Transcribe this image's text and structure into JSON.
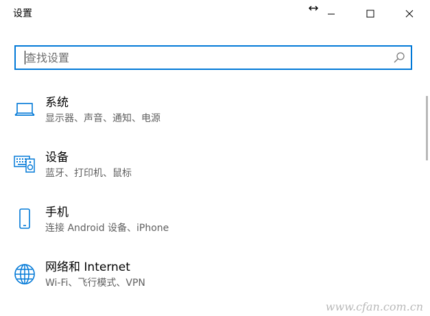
{
  "window": {
    "title": "设置"
  },
  "search": {
    "placeholder": "查找设置",
    "value": ""
  },
  "items": [
    {
      "icon": "laptop-icon",
      "title": "系统",
      "subtitle": "显示器、声音、通知、电源"
    },
    {
      "icon": "keyboard-speaker-icon",
      "title": "设备",
      "subtitle": "蓝牙、打印机、鼠标"
    },
    {
      "icon": "phone-icon",
      "title": "手机",
      "subtitle": "连接 Android 设备、iPhone"
    },
    {
      "icon": "globe-icon",
      "title": "网络和 Internet",
      "subtitle": "Wi-Fi、飞行模式、VPN"
    }
  ],
  "watermark": "www.cfan.com.cn",
  "colors": {
    "accent": "#0078d7",
    "subtitle": "#5f5f5f"
  }
}
